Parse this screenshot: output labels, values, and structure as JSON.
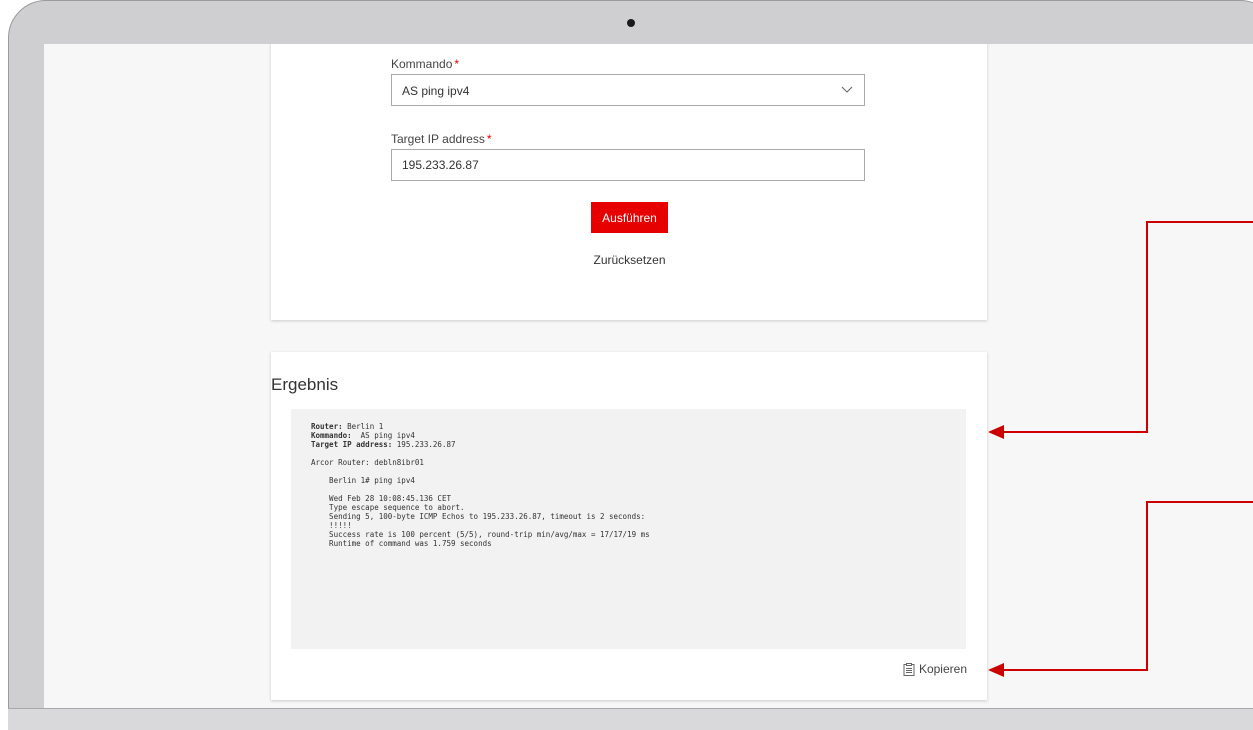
{
  "form": {
    "kommando_label": "Kommando",
    "required_mark": "*",
    "kommando_value": "AS ping ipv4",
    "target_label": "Target IP address",
    "target_value": "195.233.26.87",
    "run_button": "Ausführen",
    "reset_link": "Zurücksetzen"
  },
  "result": {
    "title": "Ergebnis",
    "router_key": "Router:",
    "router_value": " Berlin 1",
    "kommando_key": "Kommando:",
    "kommando_value": "  AS ping ipv4",
    "target_key": "Target IP address:",
    "target_value": " 195.233.26.87",
    "body": "\n\nArcor Router: debln8ibr01\n\n    Berlin 1# ping ipv4\n\n    Wed Feb 28 10:08:45.136 CET\n    Type escape sequence to abort.\n    Sending 5, 100-byte ICMP Echos to 195.233.26.87, timeout is 2 seconds:\n    !!!!!\n    Success rate is 100 percent (5/5), round-trip min/avg/max = 17/17/19 ms\n    Runtime of command was 1.759 seconds",
    "copy_label": "Kopieren"
  },
  "colors": {
    "accent": "#e60000",
    "output_bg": "#f2f2f2",
    "screen_bg": "#f7f7f7"
  }
}
